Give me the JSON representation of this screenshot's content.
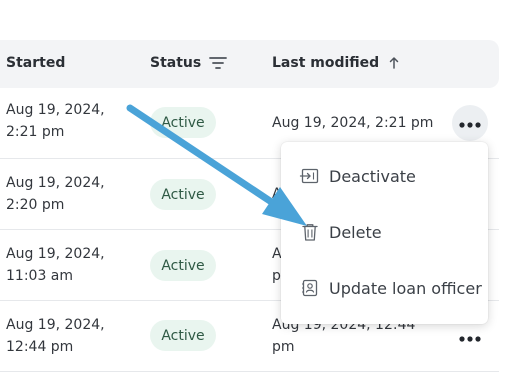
{
  "table": {
    "headers": {
      "started": "Started",
      "status": "Status",
      "last_modified": "Last modified"
    },
    "header_icons": {
      "status": "filter-lines-icon",
      "last_modified": "arrow-up-icon"
    },
    "rows": [
      {
        "started": "Aug 19, 2024,\n2:21 pm",
        "status": "Active",
        "last_modified": "Aug 19, 2024, 2:21 pm"
      },
      {
        "started": "Aug 19, 2024,\n2:20 pm",
        "status": "Active",
        "last_modified": "A"
      },
      {
        "started": "Aug 19, 2024,\n11:03 am",
        "status": "Active",
        "last_modified": "A\np"
      },
      {
        "started": "Aug 19, 2024,\n12:44 pm",
        "status": "Active",
        "last_modified": "Aug 19, 2024, 12:44\npm"
      }
    ]
  },
  "dropdown": {
    "items": [
      {
        "label": "Deactivate",
        "icon": "deactivate-icon"
      },
      {
        "label": "Delete",
        "icon": "trash-icon"
      },
      {
        "label": "Update loan officer",
        "icon": "user-card-icon"
      }
    ]
  },
  "colors": {
    "accent_arrow": "#4aa3d8",
    "active_badge_bg": "#e9f5ef",
    "active_badge_text": "#2f5a45",
    "header_bg": "#f3f4f6"
  }
}
